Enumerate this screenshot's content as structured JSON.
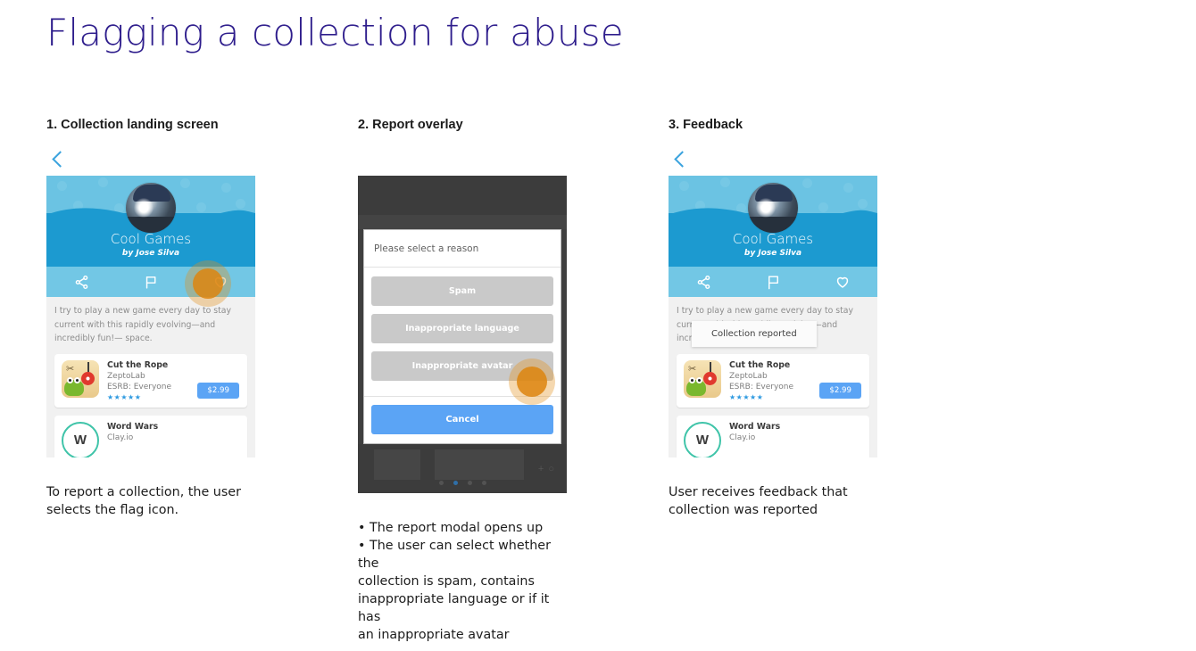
{
  "title": "Flagging a collection for abuse",
  "theme": {
    "title_color": "#2E1D8C",
    "banner_top": "#6BC3E3",
    "banner_bottom": "#1C9AD0",
    "action_bar": "#72C7E5",
    "accent_blue": "#5BA4F5",
    "tap_orange": "#DD850E",
    "scrim": "#3C3C3C"
  },
  "collection": {
    "name": "Cool Games",
    "author": "by Jose Silva",
    "description": "I try to play a new game every day to stay current with this rapidly evolving—and incredibly fun!— space.",
    "actions": [
      {
        "name": "share-icon",
        "label": "Share"
      },
      {
        "name": "flag-icon",
        "label": "Flag"
      },
      {
        "name": "heart-icon",
        "label": "Favorite"
      }
    ],
    "apps": [
      {
        "name": "Cut the Rope",
        "developer": "ZeptoLab",
        "esrb": "ESRB: Everyone",
        "rating": "★★★★★",
        "price": "$2.99"
      },
      {
        "name": "Word Wars",
        "developer": "Clay.io",
        "icon_letter": "W"
      }
    ]
  },
  "panels": [
    {
      "heading": "1. Collection landing screen",
      "caption_lines": [
        "To report a collection, the user",
        "selects the flag icon."
      ]
    },
    {
      "heading": "2. Report overlay",
      "caption_lines": [
        "• The report modal opens up",
        "• The user can select whether the",
        "collection is spam, contains",
        "inappropriate language or if it has",
        "an inappropriate avatar"
      ]
    },
    {
      "heading": "3. Feedback",
      "caption_lines": [
        "User receives feedback that",
        "collection was reported"
      ]
    }
  ],
  "report_modal": {
    "title": "Please select a reason",
    "options": [
      "Spam",
      "Inappropriate language",
      "Inappropriate avatar"
    ],
    "cancel_label": "Cancel",
    "page_dots": {
      "count": 4,
      "active_index": 1
    },
    "add_icon": "+ ○"
  },
  "feedback": {
    "toast": "Collection reported"
  }
}
